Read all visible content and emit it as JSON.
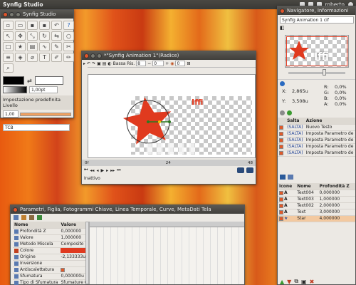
{
  "top_bar": {
    "app_title": "Synfig Studio",
    "user": "roberto"
  },
  "toolbox": {
    "title": "Synfig Studio",
    "brush_size": "1,00pt",
    "default_layer_label": "Impostazione predefinita Livello",
    "amount": "1,00",
    "interpolation": "TCB"
  },
  "canvas": {
    "title": "*\"Synfig Animation 1\"(Radice)",
    "quality_label": "Bassa Ris.",
    "quality_value": "8",
    "zoom_value": "0",
    "frame_value": "0",
    "canvas_text": "Iffi",
    "status": "Inattivo",
    "time_start": "0f",
    "time_mid": "24",
    "time_end": "48"
  },
  "navigator": {
    "title": "Navigatore, Informazioni",
    "canvas_name": "Synfig Animation 1 cif",
    "nav_text": "Iffi",
    "info": {
      "x_label": "X:",
      "x_value": "2,865u",
      "y_label": "Y:",
      "y_value": "3,508u",
      "r_label": "R:",
      "r_value": "0,0%",
      "g_label": "G:",
      "g_value": "0,0%",
      "b_label": "B:",
      "b_value": "0,0%",
      "a_label": "A:",
      "a_value": "0,0%"
    }
  },
  "history": {
    "headers": [
      "Salta",
      "Azione"
    ],
    "rows": [
      {
        "jump": "(SALTA)",
        "action": "Nuovo Testo"
      },
      {
        "jump": "(SALTA)",
        "action": "Imposta Parametro de"
      },
      {
        "jump": "(SALTA)",
        "action": "Imposta Parametro de"
      },
      {
        "jump": "(SALTA)",
        "action": "Imposta Parametro de"
      },
      {
        "jump": "(SALTA)",
        "action": "Imposta Parametro de"
      }
    ]
  },
  "layers": {
    "headers": [
      "Icone",
      "Nome",
      "Profondità Z"
    ],
    "rows": [
      {
        "name": "Text004",
        "depth": "0,000000"
      },
      {
        "name": "Text003",
        "depth": "1,000000"
      },
      {
        "name": "Text002",
        "depth": "2,000000"
      },
      {
        "name": "Text",
        "depth": "3,000000"
      },
      {
        "name": "Star",
        "depth": "4,000000"
      }
    ]
  },
  "params": {
    "title": "Parametri, Figlia, Fotogrammi Chiave, Linea Temporale, Curve, MetaDati Tela",
    "headers": [
      "Nome",
      "Valore"
    ],
    "rows": [
      {
        "name": "Profondità Z",
        "value": "0,000000"
      },
      {
        "name": "Valore",
        "value": "1,000000"
      },
      {
        "name": "Metodo Miscela",
        "value": "Composito"
      },
      {
        "name": "Colore",
        "value": ""
      },
      {
        "name": "Origine",
        "value": "-2,133333u,0,06666"
      },
      {
        "name": "Inversione",
        "value": ""
      },
      {
        "name": "Antiscalettatura",
        "value": ""
      },
      {
        "name": "Sfumatura",
        "value": "0,000000u"
      },
      {
        "name": "Tipo di Sfumatura",
        "value": "Sfumature Gaussiane"
      }
    ]
  }
}
